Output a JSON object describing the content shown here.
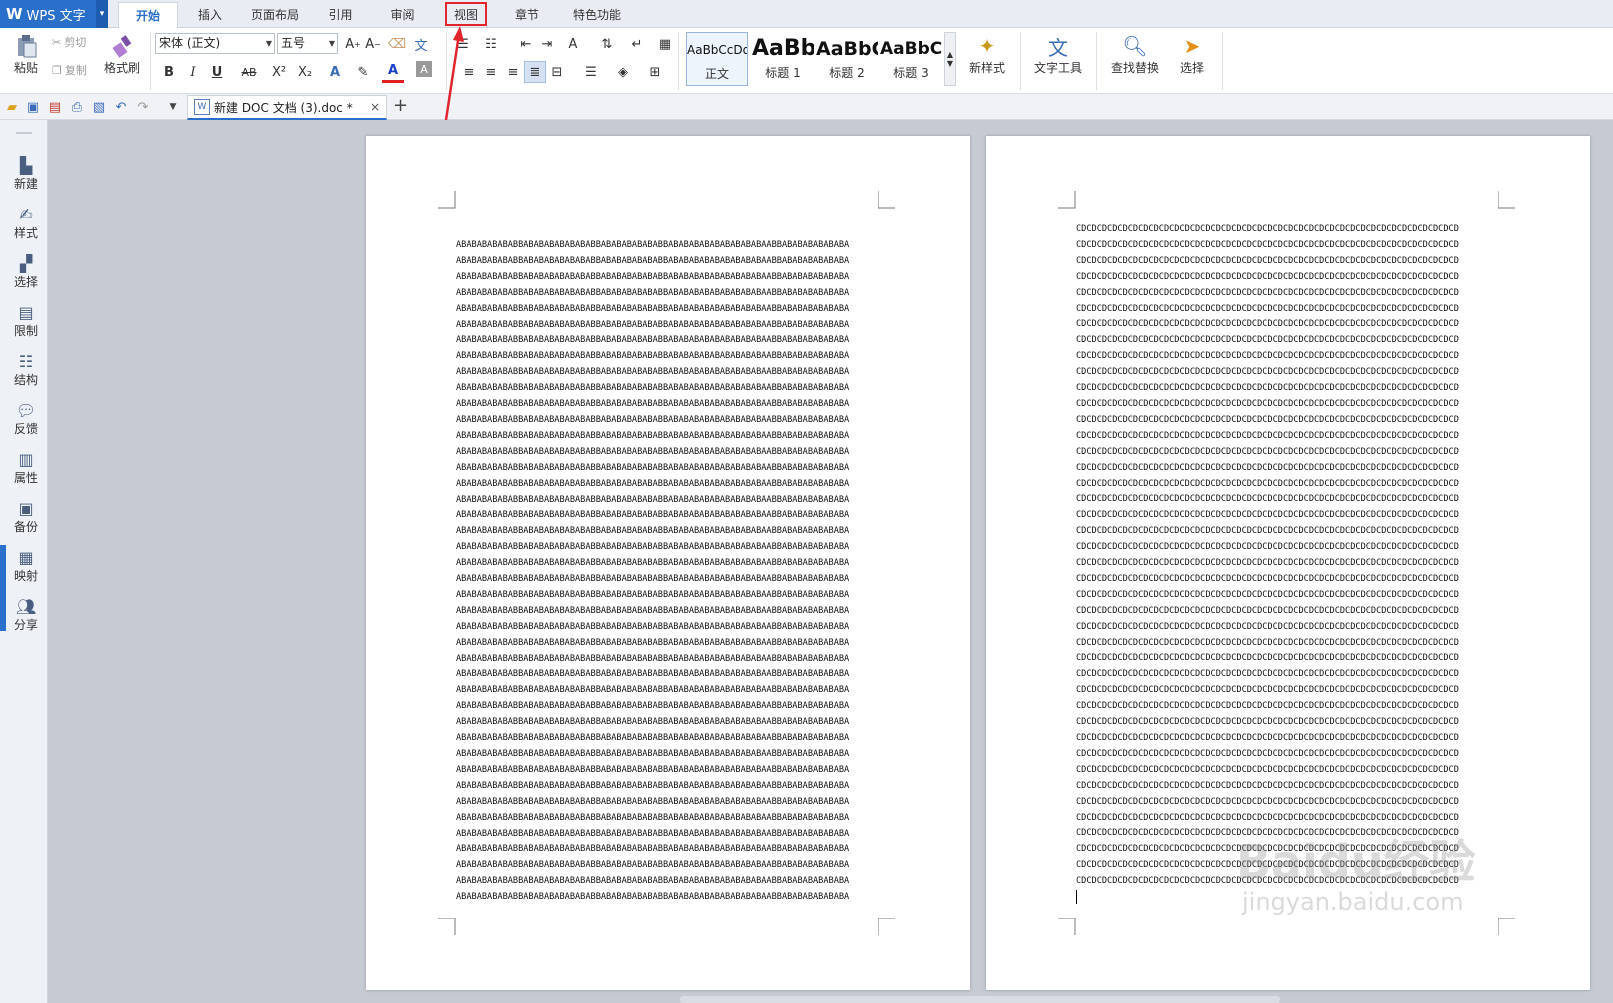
{
  "app": {
    "logo_mark": "W",
    "title": "WPS 文字",
    "menu_arrow": "▾"
  },
  "ribbon_tabs": [
    {
      "id": "home",
      "label": "开始",
      "active": true
    },
    {
      "id": "insert",
      "label": "插入"
    },
    {
      "id": "layout",
      "label": "页面布局"
    },
    {
      "id": "references",
      "label": "引用"
    },
    {
      "id": "review",
      "label": "审阅"
    },
    {
      "id": "view",
      "label": "视图",
      "highlighted": true
    },
    {
      "id": "chapter",
      "label": "章节"
    },
    {
      "id": "special",
      "label": "特色功能"
    }
  ],
  "clipboard": {
    "paste_label": "粘贴",
    "cut_label": "剪切",
    "copy_label": "复制",
    "format_painter_label": "格式刷"
  },
  "font": {
    "name": "宋体 (正文)",
    "size": "五号",
    "bold": "B",
    "italic": "I",
    "underline": "U",
    "strike": "AB",
    "superscript": "X²",
    "subscript": "X₂",
    "color": "A",
    "highlight": "A"
  },
  "styles": {
    "items": [
      {
        "preview": "AaBbCcDd",
        "label": "正文"
      },
      {
        "preview": "AaBb",
        "label": "标题 1"
      },
      {
        "preview": "AaBbC",
        "label": "标题 2"
      },
      {
        "preview": "AaBbC",
        "label": "标题 3"
      }
    ],
    "new_style_label": "新样式"
  },
  "tools": {
    "text_tools_label": "文字工具",
    "find_replace_label": "查找替换",
    "select_label": "选择"
  },
  "document_tab": {
    "name": "新建 DOC 文档 (3).doc *",
    "close": "×",
    "add": "+"
  },
  "sidebar": [
    {
      "icon": "new-icon",
      "label": "新建"
    },
    {
      "icon": "style-icon",
      "label": "样式"
    },
    {
      "icon": "select-icon",
      "label": "选择"
    },
    {
      "icon": "restrict-icon",
      "label": "限制"
    },
    {
      "icon": "structure-icon",
      "label": "结构"
    },
    {
      "icon": "feedback-icon",
      "label": "反馈"
    },
    {
      "icon": "properties-icon",
      "label": "属性"
    },
    {
      "icon": "backup-icon",
      "label": "备份"
    },
    {
      "icon": "mapping-icon",
      "label": "映射"
    },
    {
      "icon": "share-icon",
      "label": "分享"
    }
  ],
  "pages": [
    {
      "line": "ABABABABABABBABABABABABABABBABABABABABABBABABABABABABABABABAABBABABABABABABA",
      "count": 42
    },
    {
      "line": "CDCDCDCDCDCDCDCDCDCDCDCDCDCDCDCDCDCDCDCDCDCDCDCDCDCDCDCDCDCDCDCDCDCDCDCDCD",
      "count": 42
    }
  ],
  "watermark": {
    "line1": "Baidu经验",
    "line2": "jingyan.baidu.com"
  },
  "colors": {
    "accent": "#2a6fc9",
    "highlight_border": "#e0262c"
  }
}
